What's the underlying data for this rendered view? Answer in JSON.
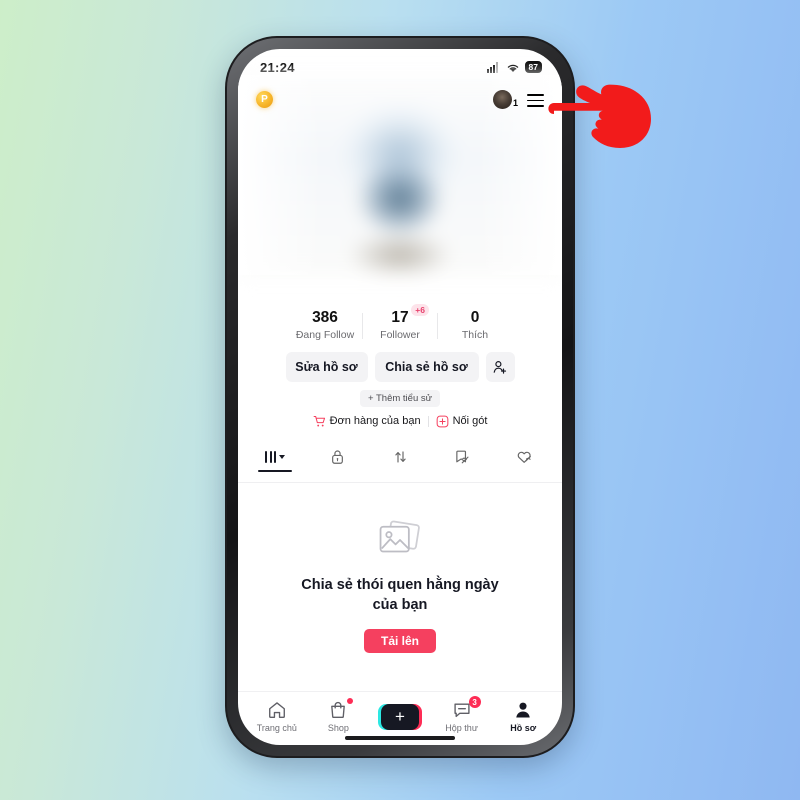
{
  "background": {
    "gradient_from": "#cdeec9",
    "gradient_to": "#8fb8f2"
  },
  "status_bar": {
    "time": "21:24",
    "battery_level": "87",
    "signal_icon": "cellular-signal-icon",
    "wifi_icon": "wifi-icon",
    "battery_icon": "battery-icon"
  },
  "header": {
    "coin_label": "P",
    "coin_icon": "points-coin-icon",
    "avatar_icon": "account-avatar-icon",
    "avatar_count": "1",
    "menu_icon": "hamburger-menu-icon"
  },
  "profile": {
    "stats": [
      {
        "value": "386",
        "label": "Đang Follow",
        "badge": ""
      },
      {
        "value": "17",
        "label": "Follower",
        "badge": "+6"
      },
      {
        "value": "0",
        "label": "Thích",
        "badge": ""
      }
    ],
    "buttons": {
      "edit": "Sửa hồ sơ",
      "share": "Chia sẻ hồ sơ",
      "add_user_icon": "add-person-icon"
    },
    "add_bio": "+ Thêm tiểu sử",
    "links": [
      {
        "label": "Đơn hàng của bạn",
        "icon": "shopping-cart-icon"
      },
      {
        "label": "Nối gót",
        "icon": "footsteps-badge-icon"
      }
    ]
  },
  "tabs": [
    {
      "name": "posts",
      "icon": "grid-dropdown-icon",
      "active": true
    },
    {
      "name": "private",
      "icon": "lock-icon",
      "active": false
    },
    {
      "name": "reposts",
      "icon": "repost-arrows-icon",
      "active": false
    },
    {
      "name": "saved",
      "icon": "bookmark-hidden-icon",
      "active": false
    },
    {
      "name": "liked",
      "icon": "heart-hidden-icon",
      "active": false
    }
  ],
  "empty_state": {
    "icon": "photo-stack-icon",
    "title": "Chia sẻ thói quen hằng ngày của bạn",
    "upload_button": "Tải lên",
    "accent_color": "#f5405f"
  },
  "bottom_nav": [
    {
      "label": "Trang chủ",
      "icon": "home-icon",
      "badge": "",
      "dot": false,
      "active": false
    },
    {
      "label": "Shop",
      "icon": "shop-bag-icon",
      "badge": "",
      "dot": true,
      "active": false
    },
    {
      "label": "",
      "icon": "create-plus-icon",
      "badge": "",
      "dot": false,
      "active": false
    },
    {
      "label": "Hộp thư",
      "icon": "inbox-message-icon",
      "badge": "3",
      "dot": false,
      "active": false
    },
    {
      "label": "Hồ sơ",
      "icon": "profile-person-icon",
      "badge": "",
      "dot": false,
      "active": true
    }
  ],
  "pointer": {
    "icon": "pointing-hand-cursor",
    "color": "#f21b1b",
    "target": "hamburger-menu-icon"
  }
}
